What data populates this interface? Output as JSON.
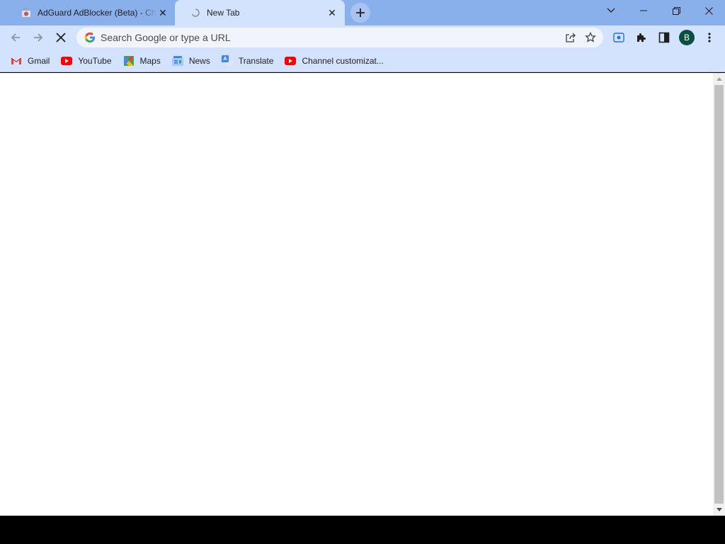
{
  "tabs": [
    {
      "title": "AdGuard AdBlocker (Beta) - Chrome Web Store",
      "active": false,
      "favicon": "chrome-web-store-icon"
    },
    {
      "title": "New Tab",
      "active": true,
      "favicon": "loading-icon"
    }
  ],
  "window_controls": [
    "tab-search-icon",
    "minimize-icon",
    "restore-icon",
    "close-icon"
  ],
  "omnibox": {
    "placeholder": "Search Google or type a URL"
  },
  "profile": {
    "initial": "B"
  },
  "bookmarks": [
    {
      "label": "Gmail",
      "icon": "gmail-icon"
    },
    {
      "label": "YouTube",
      "icon": "youtube-icon"
    },
    {
      "label": "Maps",
      "icon": "maps-icon"
    },
    {
      "label": "News",
      "icon": "news-icon"
    },
    {
      "label": "Translate",
      "icon": "translate-icon"
    },
    {
      "label": "Channel customizat...",
      "icon": "youtube-icon"
    }
  ],
  "colors": {
    "tabstrip": "#8ab0ec",
    "toolbar": "#d3e3fd",
    "avatar": "#0b4f3f"
  }
}
